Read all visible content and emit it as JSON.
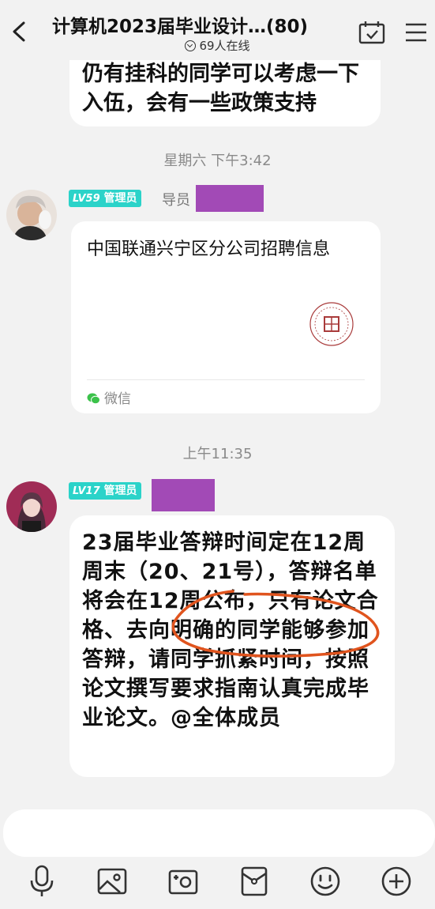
{
  "header": {
    "title": "计算机2023届毕业设计…(80)",
    "online": "69人在线"
  },
  "messages": {
    "first_bubble_text": "仍有挂科的同学可以考虑一下入伍，会有一些政策支持",
    "timestamp_1": "星期六 下午3:42",
    "msg2": {
      "level": "LV59",
      "role": "管理员",
      "title_label": "导员",
      "card_title": "中国联通兴宁区分公司招聘信息",
      "card_source": "微信"
    },
    "timestamp_2": "上午11:35",
    "msg3": {
      "level": "LV17",
      "role": "管理员",
      "text": "23届毕业答辩时间定在12周周末（20、21号），答辩名单将会在12周公布，只有论文合格、去向明确的同学能够参加答辩，请同学抓紧时间，按照论文撰写要求指南认真完成毕业论文。@全体成员"
    }
  },
  "toolbar": {
    "icons": [
      "microphone-icon",
      "image-icon",
      "camera-icon",
      "red-packet-icon",
      "emoji-icon",
      "plus-icon"
    ]
  },
  "colors": {
    "level_badge": "#2bd3c9",
    "redaction": "#a24ab6",
    "annotation_circle": "#e0541e",
    "background": "#f2f2f2"
  }
}
